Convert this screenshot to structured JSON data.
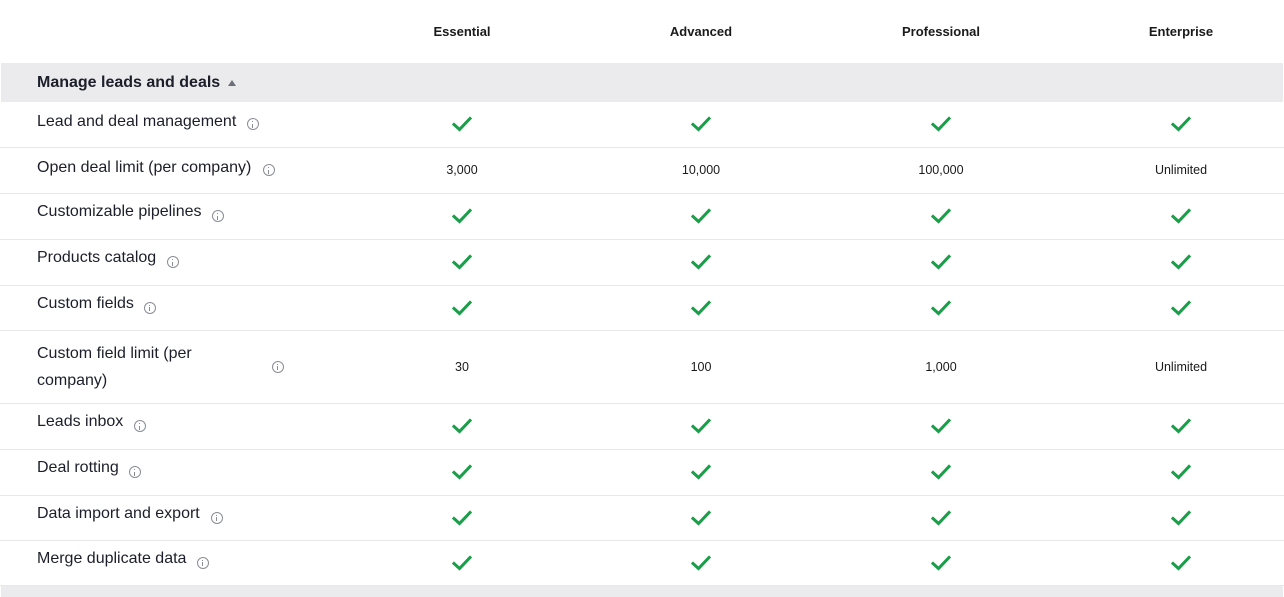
{
  "plans": [
    "Essential",
    "Advanced",
    "Professional",
    "Enterprise"
  ],
  "section": {
    "title": "Manage leads and deals"
  },
  "rows": [
    {
      "label": "Lead and deal management",
      "values": [
        "check",
        "check",
        "check",
        "check"
      ]
    },
    {
      "label": "Open deal limit (per company)",
      "values": [
        "3,000",
        "10,000",
        "100,000",
        "Unlimited"
      ]
    },
    {
      "label": "Customizable pipelines",
      "values": [
        "check",
        "check",
        "check",
        "check"
      ]
    },
    {
      "label": "Products catalog",
      "values": [
        "check",
        "check",
        "check",
        "check"
      ]
    },
    {
      "label": "Custom fields",
      "values": [
        "check",
        "check",
        "check",
        "check"
      ]
    },
    {
      "label": "Custom field limit (per company)",
      "values": [
        "30",
        "100",
        "1,000",
        "Unlimited"
      ]
    },
    {
      "label": "Leads inbox",
      "values": [
        "check",
        "check",
        "check",
        "check"
      ]
    },
    {
      "label": "Deal rotting",
      "values": [
        "check",
        "check",
        "check",
        "check"
      ]
    },
    {
      "label": "Data import and export",
      "values": [
        "check",
        "check",
        "check",
        "check"
      ]
    },
    {
      "label": "Merge duplicate data",
      "values": [
        "check",
        "check",
        "check",
        "check"
      ]
    }
  ],
  "icons": {
    "included": "check-icon",
    "info": "info-icon",
    "collapse": "caret-up-icon"
  },
  "colors": {
    "check": "#1a9e49",
    "section_bg": "#ebebed"
  }
}
